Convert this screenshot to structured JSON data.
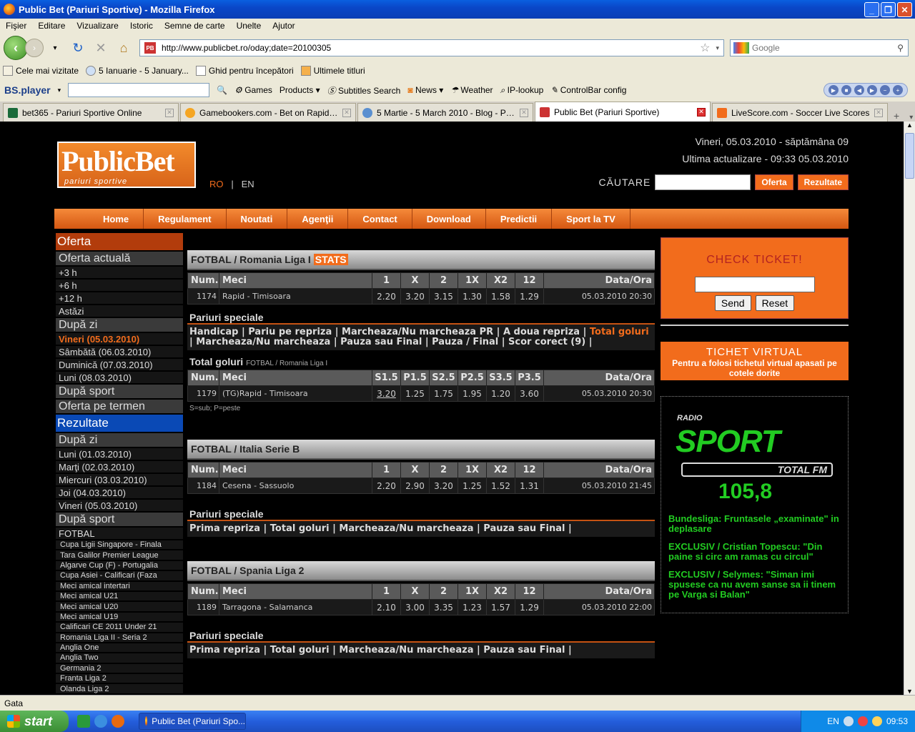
{
  "window": {
    "title": "Public Bet (Pariuri Sportive) - Mozilla Firefox",
    "controls": [
      "_",
      "❐",
      "✕"
    ]
  },
  "menu": [
    "Fişier",
    "Editare",
    "Vizualizare",
    "Istoric",
    "Semne de carte",
    "Unelte",
    "Ajutor"
  ],
  "nav": {
    "url": "http://www.publicbet.ro/oday;date=20100305",
    "search_placeholder": "Google"
  },
  "bookmarks": [
    "Cele mai vizitate",
    "5 Ianuarie - 5 January...",
    "Ghid pentru începători",
    "Ultimele titluri"
  ],
  "toolbar2": {
    "brand": "BS.player",
    "items": [
      "Games",
      "Products",
      "Subtitles Search",
      "News",
      "Weather",
      "IP-lookup",
      "ControlBar config"
    ]
  },
  "tabs": [
    {
      "label": "bet365 - Pariuri Sportive Online",
      "color": "#1a6a3a"
    },
    {
      "label": "Gamebookers.com - Bet on Rapid B. v ...",
      "color": "#f5a623"
    },
    {
      "label": "5 Martie - 5 March 2010 - Blog - Pariuri...",
      "color": "#5a8fd0"
    },
    {
      "label": "Public Bet (Pariuri Sportive)",
      "color": "#cc3333",
      "active": true
    },
    {
      "label": "LiveScore.com - Soccer Live Scores",
      "color": "#f26c1c"
    }
  ],
  "site": {
    "logo_main": "PublicBet",
    "logo_sub": "pariuri sportive",
    "lang_ro": "RO",
    "lang_sep": "|",
    "lang_en": "EN",
    "date_line": "Vineri, 05.03.2010 - săptămâna 09",
    "update_line": "Ultima actualizare - 09:33 05.03.2010",
    "search_label": "CĂUTARE",
    "btn_oferta": "Oferta",
    "btn_rezultate": "Rezultate",
    "mainnav": [
      "Home",
      "Regulament",
      "Noutati",
      "Agenţii",
      "Contact",
      "Download",
      "Predictii",
      "Sport la TV"
    ]
  },
  "sidebar": {
    "oferta": "Oferta",
    "oferta_actuala": "Oferta actuală",
    "time_items": [
      "+3 h",
      "+6 h",
      "+12 h",
      "Astăzi"
    ],
    "dupa_zi": "După zi",
    "day_items": [
      "Vineri (05.03.2010)",
      "Sâmbătă (06.03.2010)",
      "Duminică (07.03.2010)",
      "Luni (08.03.2010)"
    ],
    "dupa_sport": "După sport",
    "oferta_termen": "Oferta pe termen",
    "rezultate": "Rezultate",
    "dupa_zi2": "După zi",
    "res_days": [
      "Luni (01.03.2010)",
      "Marţi (02.03.2010)",
      "Miercuri (03.03.2010)",
      "Joi (04.03.2010)",
      "Vineri (05.03.2010)"
    ],
    "dupa_sport2": "După sport",
    "fotbal": "FOTBAL",
    "leagues": [
      "Cupa Ligii Singapore - Finala",
      "Tara Galilor Premier League",
      "Algarve Cup (F) - Portugalia",
      "Cupa Asiei - Calificari (Faza",
      "Meci amical intertari",
      "Meci amical U21",
      "Meci amical U20",
      "Meci amical U19",
      "Calificari CE 2011 Under 21",
      "Romania Liga II - Seria 2",
      "Anglia One",
      "Anglia Two",
      "Germania 2",
      "Franta Liga 2",
      "Olanda Liga 2"
    ]
  },
  "headers": {
    "num": "Num.",
    "meci": "Meci",
    "c1": "1",
    "cx": "X",
    "c2": "2",
    "c1x": "1X",
    "cx2": "X2",
    "c12": "12",
    "data": "Data/Ora"
  },
  "tg_headers": {
    "num": "Num.",
    "meci": "Meci",
    "h1": "S1.5",
    "h2": "P1.5",
    "h3": "S2.5",
    "h4": "P2.5",
    "h5": "S3.5",
    "h6": "P3.5",
    "data": "Data/Ora"
  },
  "sec1": {
    "title": "FOTBAL / Romania Liga I",
    "stats": "STATS",
    "row": {
      "num": "1174",
      "match": "Rapid - Timisoara",
      "o1": "2.20",
      "ox": "3.20",
      "o2": "3.15",
      "o1x": "1.30",
      "ox2": "1.58",
      "o12": "1.29",
      "date": "05.03.2010 20:30"
    },
    "spec_title": "Pariuri speciale",
    "spec_links_a": "Handicap | Pariu pe repriza | Marcheaza/Nu marcheaza PR | A doua repriza |",
    "spec_links_hl": "Total goluri",
    "spec_links_b": "| Marcheaza/Nu marcheaza | Pauza sau Final | Pauza / Final | Scor corect (9) |",
    "tg_title": "Total goluri",
    "tg_sub": "FOTBAL / Romania Liga I",
    "tg_row": {
      "num": "1179",
      "match": "(TG)Rapid - Timisoara",
      "v1": "3.20",
      "v2": "1.25",
      "v3": "1.75",
      "v4": "1.95",
      "v5": "1.20",
      "v6": "3.60",
      "date": "05.03.2010 20:30"
    },
    "note": "S=sub; P=peste"
  },
  "sec2": {
    "title": "FOTBAL / Italia Serie B",
    "row": {
      "num": "1184",
      "match": "Cesena - Sassuolo",
      "o1": "2.20",
      "ox": "2.90",
      "o2": "3.20",
      "o1x": "1.25",
      "ox2": "1.52",
      "o12": "1.31",
      "date": "05.03.2010 21:45"
    },
    "spec_title": "Pariuri speciale",
    "spec_links": "Prima repriza | Total goluri | Marcheaza/Nu marcheaza | Pauza sau Final |"
  },
  "sec3": {
    "title": "FOTBAL / Spania Liga 2",
    "row": {
      "num": "1189",
      "match": "Tarragona - Salamanca",
      "o1": "2.10",
      "ox": "3.00",
      "o2": "3.35",
      "o1x": "1.23",
      "ox2": "1.57",
      "o12": "1.29",
      "date": "05.03.2010 22:00"
    },
    "spec_title": "Pariuri speciale",
    "spec_links": "Prima repriza | Total goluri | Marcheaza/Nu marcheaza | Pauza sau Final |"
  },
  "right": {
    "check_title": "CHECK TICKET!",
    "send": "Send",
    "reset": "Reset",
    "virt_title": "TICHET VIRTUAL",
    "virt_sub": "Pentru a folosi tichetul virtual apasati pe cotele dorite",
    "radio_top": "RADIO",
    "radio_main": "SPORT",
    "radio_band": "TOTAL FM",
    "radio_freq": "105,8",
    "news": [
      "Bundesliga: Fruntasele „examinate\" in deplasare",
      "EXCLUSIV / Cristian Topescu: \"Din paine si circ am ramas cu circul\"",
      "EXCLUSIV / Selymes: \"Siman imi spusese ca nu avem sanse sa ii tinem pe Varga si Balan\""
    ]
  },
  "status": "Gata",
  "taskbar": {
    "start": "start",
    "item": "Public Bet (Pariuri Spo...",
    "lang": "EN",
    "clock": "09:53"
  }
}
